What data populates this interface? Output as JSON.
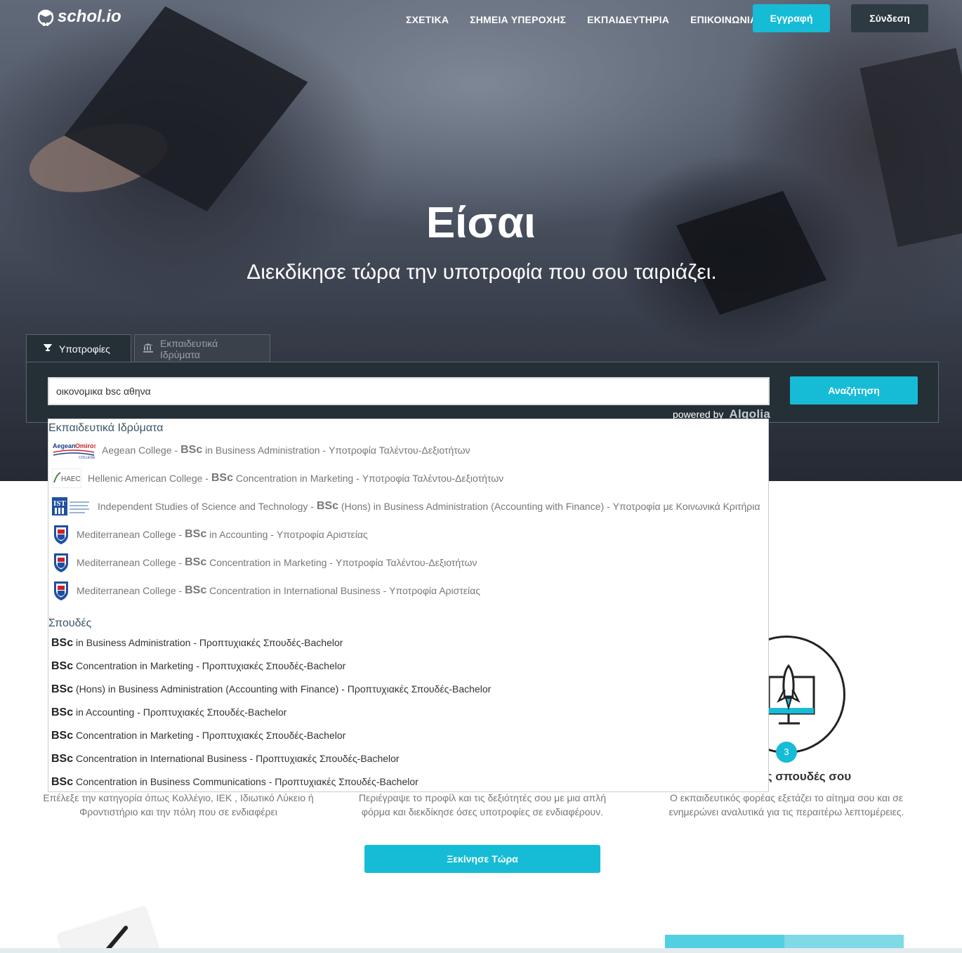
{
  "nav": {
    "logo_text": "schol.io",
    "links": [
      "ΣΧΕΤΙΚΑ",
      "ΣΗΜΕΙΑ ΥΠΕΡΟΧΗΣ",
      "ΕΚΠΑΙΔΕΥΤΗΡΙΑ",
      "ΕΠΙΚΟΙΝΩΝΙΑ"
    ],
    "register_label": "Εγγραφή",
    "login_label": "Σύνδεση"
  },
  "hero": {
    "title": "Είσαι",
    "subtitle": "Διεκδίκησε τώρα την υποτροφία που σου ταιριάζει."
  },
  "search": {
    "tabs": [
      {
        "label": "Υποτροφίες",
        "icon": "trophy-icon",
        "active": true
      },
      {
        "label": "Εκπαιδευτικά Ιδρύματα",
        "icon": "institution-icon",
        "active": false
      }
    ],
    "query": "οικονομικα bsc αθηνα",
    "button_label": "Αναζήτηση",
    "powered_by": "powered by",
    "provider": "Algolia"
  },
  "dropdown": {
    "institutions_header": "Εκπαιδευτικά Ιδρύματα",
    "institutions": [
      {
        "logo": "aegean-omiros-logo",
        "school": "Aegean College",
        "degree": "BSc",
        "program": "in Business Administration",
        "scholarship": "Υποτροφία Ταλέντου-Δεξιοτήτων"
      },
      {
        "logo": "haec-logo",
        "school": "Hellenic American College",
        "degree": "BSc",
        "program": "Concentration in Marketing",
        "scholarship": "Υποτροφία Ταλέντου-Δεξιοτήτων"
      },
      {
        "logo": "ist-logo",
        "school": "Independent Studies of Science and Technology",
        "degree": "BSc",
        "program": "(Hons) in Business Administration (Accounting with Finance)",
        "scholarship": "Υποτροφία με Κοινωνικά Κριτήρια"
      },
      {
        "logo": "mediterranean-college-logo",
        "school": "Mediterranean College",
        "degree": "BSc",
        "program": "in Accounting",
        "scholarship": "Υποτροφία Αριστείας"
      },
      {
        "logo": "mediterranean-college-logo",
        "school": "Mediterranean College",
        "degree": "BSc",
        "program": "Concentration in Marketing",
        "scholarship": "Υποτροφία Ταλέντου-Δεξιοτήτων"
      },
      {
        "logo": "mediterranean-college-logo",
        "school": "Mediterranean College",
        "degree": "BSc",
        "program": "Concentration in International Business",
        "scholarship": "Υποτροφία Αριστείας"
      }
    ],
    "studies_header": "Σπουδές",
    "studies": [
      {
        "degree": "BSc",
        "program": "in Business Administration",
        "type": "Προπτυχιακές Σπουδές-Bachelor"
      },
      {
        "degree": "BSc",
        "program": "Concentration in Marketing",
        "type": "Προπτυχιακές Σπουδές-Bachelor"
      },
      {
        "degree": "BSc",
        "program": "(Hons) in Business Administration (Accounting with Finance)",
        "type": "Προπτυχιακές Σπουδές-Bachelor"
      },
      {
        "degree": "BSc",
        "program": "in Accounting",
        "type": "Προπτυχιακές Σπουδές-Bachelor"
      },
      {
        "degree": "BSc",
        "program": "Concentration in Marketing",
        "type": "Προπτυχιακές Σπουδές-Bachelor"
      },
      {
        "degree": "BSc",
        "program": "Concentration in International Business",
        "type": "Προπτυχιακές Σπουδές-Bachelor"
      },
      {
        "degree": "BSc",
        "program": "Concentration in Business Communications",
        "type": "Προπτυχιακές Σπουδές-Bachelor"
      }
    ]
  },
  "steps": {
    "step3_number": "3",
    "step3_title_visible": "ις σπουδές σου",
    "step1_desc": "Επέλεξε την κατηγορία όπως Κολλέγιο, ΙΕΚ , Ιδιωτικό Λύκειο ή Φροντιστήριο και την πόλη που σε ενδιαφέρει",
    "step2_desc": "Περιέγραψε το προφίλ και τις δεξιότητές σου με μια απλή φόρμα και διεκδίκησε όσες υποτροφίες σε ενδιαφέρουν.",
    "step3_desc": "Ο εκπαιδευτικός φορέας εξετάζει το αίτημα σου και σε ενημερώνει αναλυτικά για τις περαιτέρω λεπτομέρειες."
  },
  "cta": {
    "start_label": "Ξεκίνησε Τώρα"
  },
  "colors": {
    "accent": "#16bcd6",
    "dark": "#242f36",
    "login": "#2e3a42"
  }
}
